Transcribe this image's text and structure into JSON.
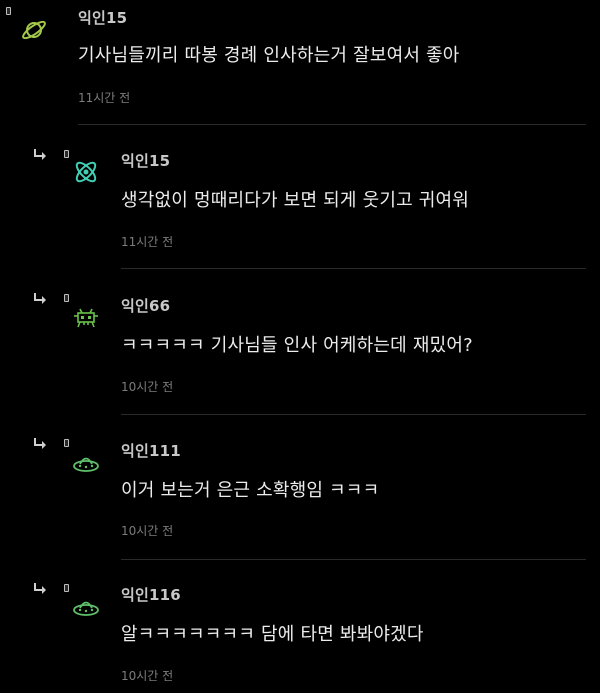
{
  "comments": [
    {
      "nickname": "익인15",
      "text": "기사님들끼리 따봉 경례 인사하는거 잘보여서 좋아",
      "time": "11시간 전",
      "avatar_icon": "saturn-icon",
      "reply": false,
      "avatar_color": "#a4c94a"
    },
    {
      "nickname": "익인15",
      "text": "생각없이 멍때리다가 보면 되게 웃기고 귀여워",
      "time": "11시간 전",
      "avatar_icon": "atom-icon",
      "reply": true,
      "avatar_color": "#3fd1b4"
    },
    {
      "nickname": "익인66",
      "text": "ㅋㅋㅋㅋㅋ 기사님들 인사 어케하는데 재밌어?",
      "time": "10시간 전",
      "avatar_icon": "space-invader-icon",
      "reply": true,
      "avatar_color": "#6ac24a"
    },
    {
      "nickname": "익인111",
      "text": "이거 보는거 은근 소확행임 ㅋㅋㅋ",
      "time": "10시간 전",
      "avatar_icon": "ufo-icon",
      "reply": true,
      "avatar_color": "#5fbf6a"
    },
    {
      "nickname": "익인116",
      "text": "알ㅋㅋㅋㅋㅋㅋㅋ 담에 타면 봐봐야겠다",
      "time": "10시간 전",
      "avatar_icon": "ufo-icon",
      "reply": true,
      "avatar_color": "#5fbf6a"
    }
  ]
}
